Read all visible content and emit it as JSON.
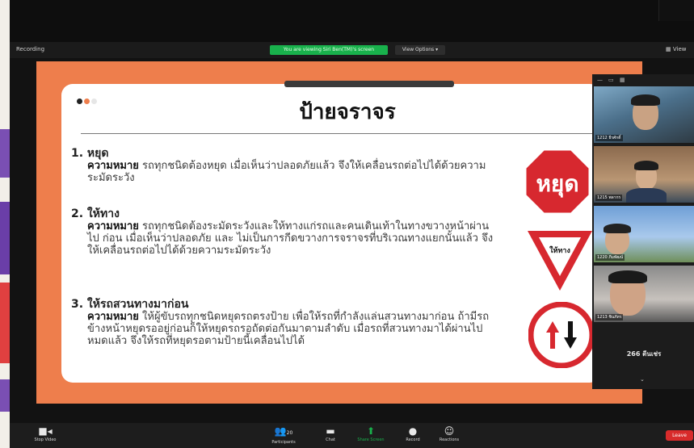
{
  "top": {
    "recording": "Recording",
    "share_status": "You are viewing Siri Ben(TM)'s screen",
    "view_options": "View Options",
    "view": "View"
  },
  "slide": {
    "title": "ป้ายจราจร",
    "items": [
      {
        "heading": "1.  หยุด",
        "meaning_label": "ความหมาย",
        "text": " รถทุกชนิดต้องหยุด เมื่อเห็นว่าปลอดภัยแล้ว จึงให้เคลื่อนรถต่อไปได้ด้วยความระมัดระวัง"
      },
      {
        "heading": "2. ให้ทาง",
        "meaning_label": "ความหมาย",
        "text": " รถทุกชนิดต้องระมัดระวังและให้ทางแก่รถและคนเดินเท้าในทางขวางหน้าผ่านไป ก่อน เมื่อเห็นว่าปลอดภัย และ ไม่เป็นการกีดขวางการจราจรที่บริเวณทางแยกนั้นแล้ว  จึงให้เคลื่อนรถต่อไปได้ด้วยความระมัดระวัง"
      },
      {
        "heading": "3. ให้รถสวนทางมาก่อน",
        "meaning_label": "ความหมาย",
        "text": " ให้ผู้ขับรถทุกชนิดหยุดรถตรงป้าย เพื่อให้รถที่กำลังแล่นสวนทางมาก่อน ถ้ามีรถข้างหน้าหยุดรออยู่ก่อนก็ให้หยุดรถรอถัดต่อกันมาตามลำดับ เมื่อรถที่สวนทางมาได้ผ่านไปหมดแล้ว จึงให้รถที่หยุดรอตามป้ายนี้เคลื่อนไปได้"
      }
    ],
    "stop_sign_text": "หยุด",
    "yield_sign_text": "ให้ทาง"
  },
  "participants": {
    "tiles": [
      {
        "name": "1212 ธีรศักดิ์"
      },
      {
        "name": "1215 พลากร"
      },
      {
        "name": "1220 ภีมพัฒน์"
      },
      {
        "name": "1213 ชินภัทร"
      }
    ],
    "more": "266 ตีนเช่ร"
  },
  "toolbar": {
    "stop_video": "Stop Video",
    "participants": "Participants",
    "participants_count": "20",
    "chat": "Chat",
    "share_screen": "Share Screen",
    "record": "Record",
    "reactions": "Reactions",
    "leave": "Leave"
  },
  "colors": {
    "slide_orange": "#ee7e4c",
    "stop_red": "#d7282f",
    "share_green": "#19b14c",
    "leave_red": "#d82b2b"
  }
}
